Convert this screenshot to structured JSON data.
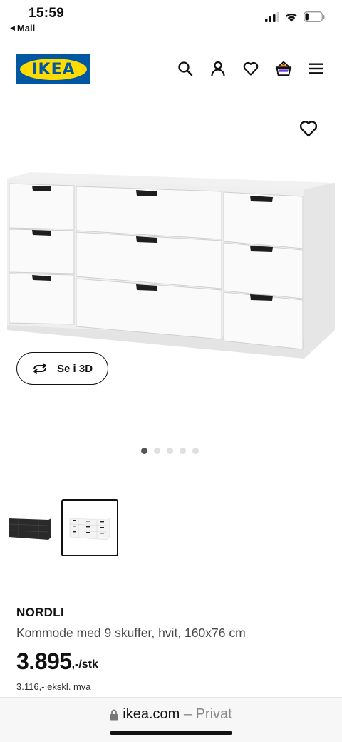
{
  "status_bar": {
    "time": "15:59",
    "back_app": "Mail",
    "back_icon": "back-triangle-icon",
    "battery_level": 0.2
  },
  "header": {
    "logo_text": "IKEA",
    "brand_colors": {
      "blue": "#0058a3",
      "yellow": "#ffdb00"
    },
    "icons": [
      "search-icon",
      "user-icon",
      "heart-icon",
      "basket-icon",
      "menu-icon"
    ]
  },
  "gallery": {
    "favorite_icon": "heart-icon",
    "view3d_label": "Se i 3D",
    "view3d_icon": "rotate-arrows-icon",
    "slide_count": 5,
    "active_slide": 1
  },
  "variants": [
    {
      "color": "black",
      "selected": false
    },
    {
      "color": "white",
      "selected": true
    }
  ],
  "product": {
    "name": "NORDLI",
    "description": "Kommode med 9 skuffer, hvit, ",
    "dimensions": "160x76 cm",
    "price": "3.895",
    "price_suffix": ",-/stk",
    "price_ex_vat": "3.116,- ekskl. mva"
  },
  "browser": {
    "domain": "ikea.com",
    "mode": " – Privat",
    "lock_icon": "lock-icon"
  }
}
